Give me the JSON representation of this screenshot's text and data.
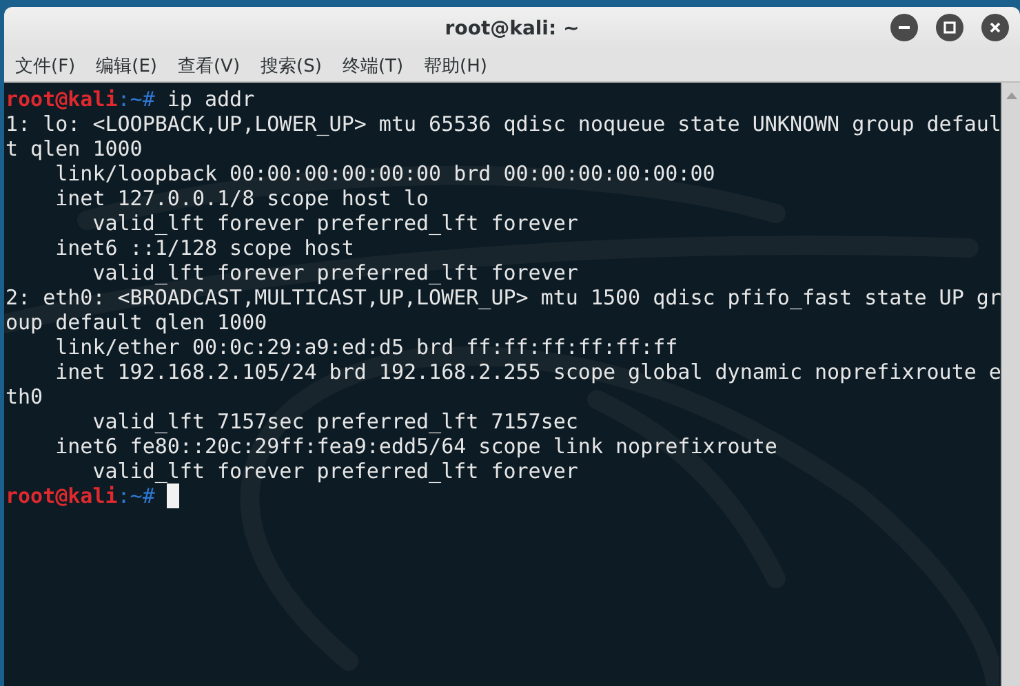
{
  "window": {
    "title": "root@kali: ~"
  },
  "menu": [
    "文件(F)",
    "编辑(E)",
    "查看(V)",
    "搜索(S)",
    "终端(T)",
    "帮助(H)"
  ],
  "terminal": {
    "lines": [
      {
        "kind": "prompt",
        "user": "root@kali",
        "path": ":~#",
        "command": " ip addr"
      },
      {
        "kind": "output",
        "text": "1: lo: <LOOPBACK,UP,LOWER_UP> mtu 65536 qdisc noqueue state UNKNOWN group defaul"
      },
      {
        "kind": "output",
        "text": "t qlen 1000"
      },
      {
        "kind": "output",
        "text": "    link/loopback 00:00:00:00:00:00 brd 00:00:00:00:00:00"
      },
      {
        "kind": "output",
        "text": "    inet 127.0.0.1/8 scope host lo"
      },
      {
        "kind": "output",
        "text": "       valid_lft forever preferred_lft forever"
      },
      {
        "kind": "output",
        "text": "    inet6 ::1/128 scope host"
      },
      {
        "kind": "output",
        "text": "       valid_lft forever preferred_lft forever"
      },
      {
        "kind": "output",
        "text": "2: eth0: <BROADCAST,MULTICAST,UP,LOWER_UP> mtu 1500 qdisc pfifo_fast state UP gr"
      },
      {
        "kind": "output",
        "text": "oup default qlen 1000"
      },
      {
        "kind": "output",
        "text": "    link/ether 00:0c:29:a9:ed:d5 brd ff:ff:ff:ff:ff:ff"
      },
      {
        "kind": "output",
        "text": "    inet 192.168.2.105/24 brd 192.168.2.255 scope global dynamic noprefixroute e"
      },
      {
        "kind": "output",
        "text": "th0"
      },
      {
        "kind": "output",
        "text": "       valid_lft 7157sec preferred_lft 7157sec"
      },
      {
        "kind": "output",
        "text": "    inet6 fe80::20c:29ff:fea9:edd5/64 scope link noprefixroute"
      },
      {
        "kind": "output",
        "text": "       valid_lft forever preferred_lft forever"
      },
      {
        "kind": "prompt",
        "user": "root@kali",
        "path": ":~#",
        "cursor": true
      }
    ]
  }
}
